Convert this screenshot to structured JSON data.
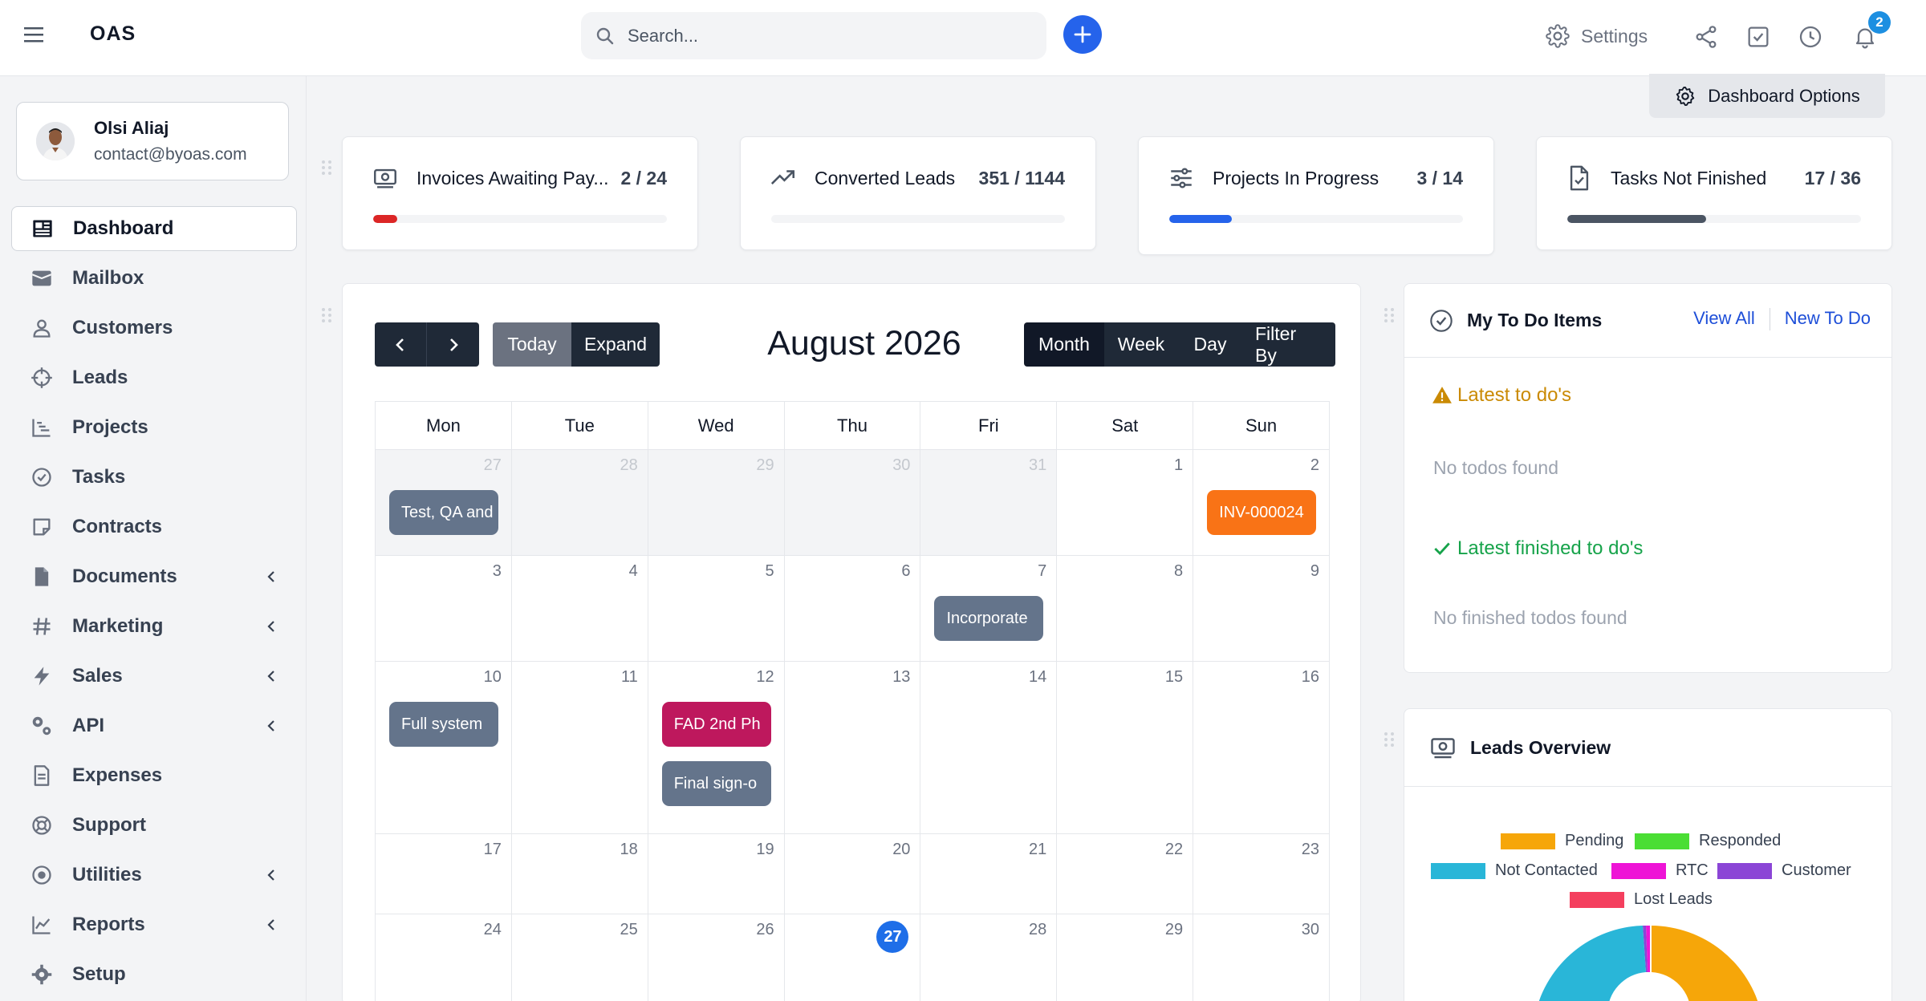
{
  "app": {
    "logo": "OAS"
  },
  "search": {
    "placeholder": "Search..."
  },
  "header": {
    "settings_label": "Settings",
    "notifications_count": "2"
  },
  "profile": {
    "name": "Olsi Aliaj",
    "email": "contact@byoas.com"
  },
  "sidebar": {
    "items": [
      {
        "label": "Dashboard",
        "icon": "dashboard-icon",
        "active": true
      },
      {
        "label": "Mailbox",
        "icon": "mail-icon"
      },
      {
        "label": "Customers",
        "icon": "user-icon"
      },
      {
        "label": "Leads",
        "icon": "crosshair-icon"
      },
      {
        "label": "Projects",
        "icon": "chart-steps-icon"
      },
      {
        "label": "Tasks",
        "icon": "check-circle-icon"
      },
      {
        "label": "Contracts",
        "icon": "note-icon"
      },
      {
        "label": "Documents",
        "icon": "document-icon",
        "has_children": true
      },
      {
        "label": "Marketing",
        "icon": "hash-icon",
        "has_children": true
      },
      {
        "label": "Sales",
        "icon": "bolt-icon",
        "has_children": true
      },
      {
        "label": "API",
        "icon": "gears-icon",
        "has_children": true
      },
      {
        "label": "Expenses",
        "icon": "receipt-icon"
      },
      {
        "label": "Support",
        "icon": "lifebuoy-icon"
      },
      {
        "label": "Utilities",
        "icon": "circle-dot-icon",
        "has_children": true
      },
      {
        "label": "Reports",
        "icon": "line-chart-icon",
        "has_children": true
      },
      {
        "label": "Setup",
        "icon": "gear-icon"
      }
    ]
  },
  "dashboard": {
    "options_label": "Dashboard Options"
  },
  "stats": [
    {
      "label": "Invoices Awaiting Pay...",
      "value": "2 / 24",
      "progress": 0.083,
      "color": "#dc2626",
      "icon": "money-icon"
    },
    {
      "label": "Converted Leads",
      "value": "351 / 1144",
      "progress": 0.0,
      "color": "#16a34a",
      "icon": "trend-up-icon"
    },
    {
      "label": "Projects In Progress",
      "value": "3 / 14",
      "progress": 0.214,
      "color": "#2563eb",
      "icon": "sliders-icon"
    },
    {
      "label": "Tasks Not Finished",
      "value": "17 / 36",
      "progress": 0.472,
      "color": "#4b5563",
      "icon": "file-check-icon"
    }
  ],
  "calendar": {
    "title": "August 2026",
    "today_label": "Today",
    "expand_label": "Expand",
    "views": [
      "Month",
      "Week",
      "Day",
      "Filter By"
    ],
    "weekdays": [
      "Mon",
      "Tue",
      "Wed",
      "Thu",
      "Fri",
      "Sat",
      "Sun"
    ],
    "weeks": [
      [
        {
          "d": "27",
          "other": true
        },
        {
          "d": "28",
          "other": true
        },
        {
          "d": "29",
          "other": true
        },
        {
          "d": "30",
          "other": true
        },
        {
          "d": "31",
          "other": true
        },
        {
          "d": "1"
        },
        {
          "d": "2"
        }
      ],
      [
        {
          "d": "3"
        },
        {
          "d": "4"
        },
        {
          "d": "5"
        },
        {
          "d": "6"
        },
        {
          "d": "7"
        },
        {
          "d": "8"
        },
        {
          "d": "9"
        }
      ],
      [
        {
          "d": "10"
        },
        {
          "d": "11"
        },
        {
          "d": "12"
        },
        {
          "d": "13"
        },
        {
          "d": "14"
        },
        {
          "d": "15"
        },
        {
          "d": "16"
        }
      ],
      [
        {
          "d": "17"
        },
        {
          "d": "18"
        },
        {
          "d": "19"
        },
        {
          "d": "20"
        },
        {
          "d": "21"
        },
        {
          "d": "22"
        },
        {
          "d": "23"
        }
      ],
      [
        {
          "d": "24"
        },
        {
          "d": "25"
        },
        {
          "d": "26"
        },
        {
          "d": "27",
          "today": true
        },
        {
          "d": "28"
        },
        {
          "d": "29"
        },
        {
          "d": "30"
        }
      ]
    ],
    "events": [
      {
        "week": 0,
        "day": 0,
        "slot": 0,
        "label": "Test, QA and",
        "color": "#64748b"
      },
      {
        "week": 0,
        "day": 6,
        "slot": 0,
        "label": "INV-000024",
        "color": "#f97316"
      },
      {
        "week": 1,
        "day": 4,
        "slot": 0,
        "label": "Incorporate",
        "color": "#64748b"
      },
      {
        "week": 2,
        "day": 0,
        "slot": 0,
        "label": "Full system",
        "color": "#64748b"
      },
      {
        "week": 2,
        "day": 2,
        "slot": 0,
        "label": "FAD 2nd Ph",
        "color": "#be185d"
      },
      {
        "week": 2,
        "day": 2,
        "slot": 1,
        "label": "Final sign-o",
        "color": "#64748b"
      }
    ]
  },
  "todo": {
    "title": "My To Do Items",
    "view_all": "View All",
    "new_todo": "New To Do",
    "latest_label": "Latest to do's",
    "latest_empty": "No todos found",
    "finished_label": "Latest finished to do's",
    "finished_empty": "No finished todos found"
  },
  "leads_overview": {
    "title": "Leads Overview",
    "legend": [
      {
        "label": "Pending",
        "color": "#f6a609"
      },
      {
        "label": "Responded",
        "color": "#4ade34"
      },
      {
        "label": "Not Contacted",
        "color": "#29b6d8"
      },
      {
        "label": "RTC",
        "color": "#ee14d6"
      },
      {
        "label": "Customer",
        "color": "#8b45d6"
      },
      {
        "label": "Lost Leads",
        "color": "#f43f5e"
      }
    ]
  }
}
